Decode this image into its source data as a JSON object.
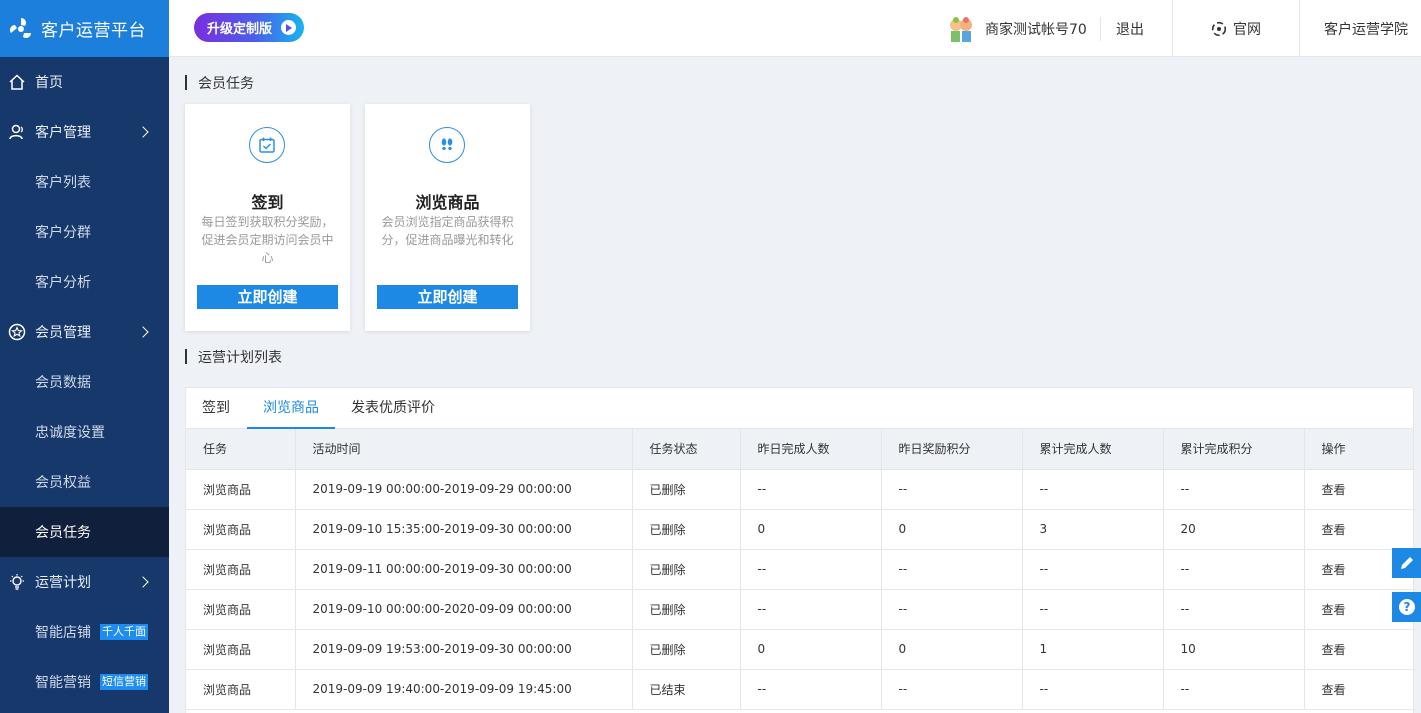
{
  "brand": {
    "title": "客户运营平台"
  },
  "sidebar": {
    "items": [
      {
        "label": "首页",
        "type": "top",
        "icon": "home-icon"
      },
      {
        "label": "客户管理",
        "type": "top",
        "icon": "user-icon",
        "arrow": true
      },
      {
        "label": "客户列表",
        "type": "sub"
      },
      {
        "label": "客户分群",
        "type": "sub"
      },
      {
        "label": "客户分析",
        "type": "sub"
      },
      {
        "label": "会员管理",
        "type": "top",
        "icon": "star-icon",
        "arrow": true
      },
      {
        "label": "会员数据",
        "type": "sub"
      },
      {
        "label": "忠诚度设置",
        "type": "sub"
      },
      {
        "label": "会员权益",
        "type": "sub"
      },
      {
        "label": "会员任务",
        "type": "sub",
        "active": true
      },
      {
        "label": "运营计划",
        "type": "top",
        "icon": "lightbulb-icon",
        "arrow": true
      },
      {
        "label": "智能店铺",
        "type": "sub",
        "badge": "千人千面"
      },
      {
        "label": "智能营销",
        "type": "sub",
        "badge": "短信营销"
      }
    ]
  },
  "header": {
    "upgrade_label": "升级定制版",
    "account_name": "商家测试帐号70",
    "logout": "退出",
    "official_site": "官网",
    "academy": "客户运营学院"
  },
  "tasks_section": {
    "title": "会员任务"
  },
  "cards": [
    {
      "title": "签到",
      "desc": "每日签到获取积分奖励，促进会员定期访问会员中心",
      "button": "立即创建",
      "icon": "calendar-check-icon"
    },
    {
      "title": "浏览商品",
      "desc": "会员浏览指定商品获得积分，促进商品曝光和转化",
      "button": "立即创建",
      "icon": "footprints-icon"
    }
  ],
  "plans_section": {
    "title": "运营计划列表"
  },
  "tabs": [
    {
      "label": "签到",
      "active": false
    },
    {
      "label": "浏览商品",
      "active": true
    },
    {
      "label": "发表优质评价",
      "active": false
    }
  ],
  "table": {
    "columns": [
      "任务",
      "活动时间",
      "任务状态",
      "昨日完成人数",
      "昨日奖励积分",
      "累计完成人数",
      "累计完成积分",
      "操作"
    ],
    "rows": [
      [
        "浏览商品",
        "2019-09-19 00:00:00-2019-09-29 00:00:00",
        "已删除",
        "--",
        "--",
        "--",
        "--",
        "查看"
      ],
      [
        "浏览商品",
        "2019-09-10 15:35:00-2019-09-30 00:00:00",
        "已删除",
        "0",
        "0",
        "3",
        "20",
        "查看"
      ],
      [
        "浏览商品",
        "2019-09-11 00:00:00-2019-09-30 00:00:00",
        "已删除",
        "--",
        "--",
        "--",
        "--",
        "查看"
      ],
      [
        "浏览商品",
        "2019-09-10 00:00:00-2020-09-09 00:00:00",
        "已删除",
        "--",
        "--",
        "--",
        "--",
        "查看"
      ],
      [
        "浏览商品",
        "2019-09-09 19:53:00-2019-09-30 00:00:00",
        "已删除",
        "0",
        "0",
        "1",
        "10",
        "查看"
      ],
      [
        "浏览商品",
        "2019-09-09 19:40:00-2019-09-09 19:45:00",
        "已结束",
        "--",
        "--",
        "--",
        "--",
        "查看"
      ]
    ]
  },
  "float_buttons": [
    {
      "icon": "pencil-icon"
    },
    {
      "icon": "help-icon"
    }
  ],
  "colors": {
    "sidebar_bg": "#17386a",
    "brand_bg": "#1d7fdc",
    "accent": "#1e88e5",
    "link": "#2e6fd6"
  }
}
